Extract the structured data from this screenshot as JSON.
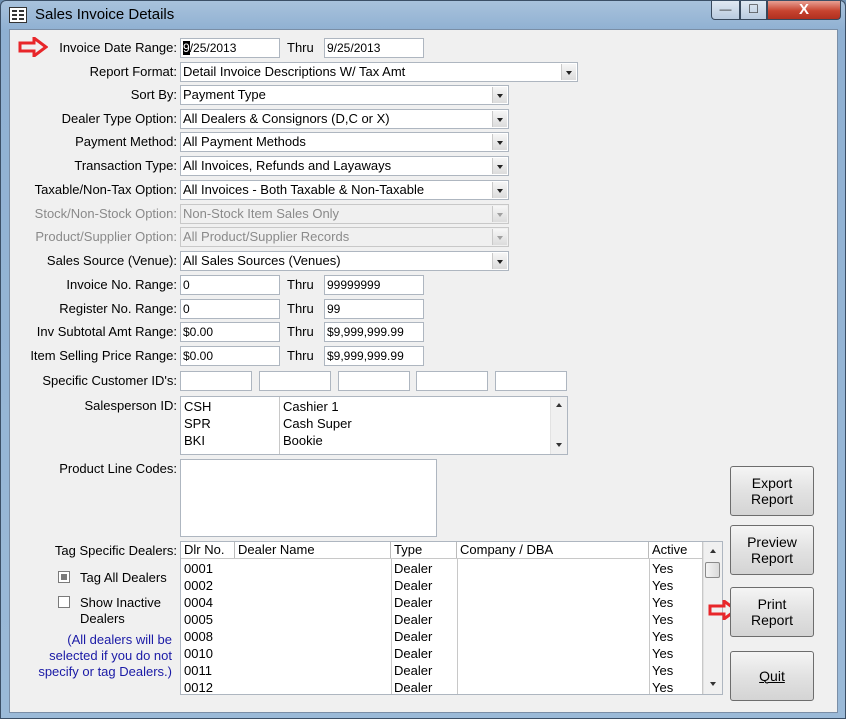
{
  "window": {
    "title": "Sales Invoice Details",
    "minimize": "—",
    "maximize": "☐",
    "close": "X"
  },
  "form": {
    "invoice_date_label": "Invoice Date Range:",
    "invoice_date_from_selected": "9",
    "invoice_date_from_rest": "/25/2013",
    "thru_label": "Thru",
    "invoice_date_thru": "9/25/2013",
    "report_format_label": "Report Format:",
    "report_format_value": "Detail Invoice Descriptions W/ Tax Amt",
    "sort_by_label": "Sort By:",
    "sort_by_value": "Payment Type",
    "dealer_type_label": "Dealer Type Option:",
    "dealer_type_value": "All Dealers & Consignors (D,C or X)",
    "payment_method_label": "Payment Method:",
    "payment_method_value": "All Payment Methods",
    "transaction_type_label": "Transaction Type:",
    "transaction_type_value": "All Invoices, Refunds and Layaways",
    "taxable_label": "Taxable/Non-Tax Option:",
    "taxable_value": "All Invoices - Both Taxable & Non-Taxable",
    "stock_label": "Stock/Non-Stock Option:",
    "stock_value": "Non-Stock Item Sales Only",
    "product_supplier_label": "Product/Supplier Option:",
    "product_supplier_value": "All Product/Supplier Records",
    "sales_source_label": "Sales Source (Venue):",
    "sales_source_value": "All Sales Sources (Venues)",
    "invoice_no_label": "Invoice No. Range:",
    "invoice_no_from": "0",
    "invoice_no_thru": "99999999",
    "register_no_label": "Register No. Range:",
    "register_no_from": "0",
    "register_no_thru": "99",
    "inv_subtotal_label": "Inv Subtotal Amt Range:",
    "inv_subtotal_from": "$0.00",
    "inv_subtotal_thru": "$9,999,999.99",
    "item_price_label": "Item Selling Price Range:",
    "item_price_from": "$0.00",
    "item_price_thru": "$9,999,999.99",
    "customer_ids_label": "Specific Customer ID's:",
    "salesperson_label": "Salesperson ID:",
    "salespersons": [
      {
        "code": "CSH",
        "name": "Cashier 1"
      },
      {
        "code": "SPR",
        "name": "Cash Super"
      },
      {
        "code": "BKI",
        "name": "Bookie"
      }
    ],
    "product_line_label": "Product Line Codes:",
    "tag_dealers_label": "Tag Specific Dealers:",
    "tag_all_label": "Tag All Dealers",
    "show_inactive_label_1": "Show Inactive",
    "show_inactive_label_2": "Dealers",
    "note_1": "(All dealers will be",
    "note_2": "selected if you do not",
    "note_3": "specify or tag Dealers.)"
  },
  "grid": {
    "headers": [
      "Dlr No.",
      "Dealer Name",
      "Type",
      "Company / DBA",
      "Active"
    ],
    "rows": [
      {
        "no": "0001",
        "type": "Dealer",
        "active": "Yes"
      },
      {
        "no": "0002",
        "type": "Dealer",
        "active": "Yes"
      },
      {
        "no": "0004",
        "type": "Dealer",
        "active": "Yes"
      },
      {
        "no": "0005",
        "type": "Dealer",
        "active": "Yes"
      },
      {
        "no": "0008",
        "type": "Dealer",
        "active": "Yes"
      },
      {
        "no": "0010",
        "type": "Dealer",
        "active": "Yes"
      },
      {
        "no": "0011",
        "type": "Dealer",
        "active": "Yes"
      },
      {
        "no": "0012",
        "type": "Dealer",
        "active": "Yes"
      }
    ]
  },
  "buttons": {
    "export_1": "Export",
    "export_2": "Report",
    "preview_1": "Preview",
    "preview_2": "Report",
    "print_1": "Print",
    "print_2": "Report",
    "quit": "Quit"
  },
  "colors": {
    "accent_red": "#e8262a",
    "title_bar": "#9bbad8",
    "close_button": "#c7432f"
  }
}
